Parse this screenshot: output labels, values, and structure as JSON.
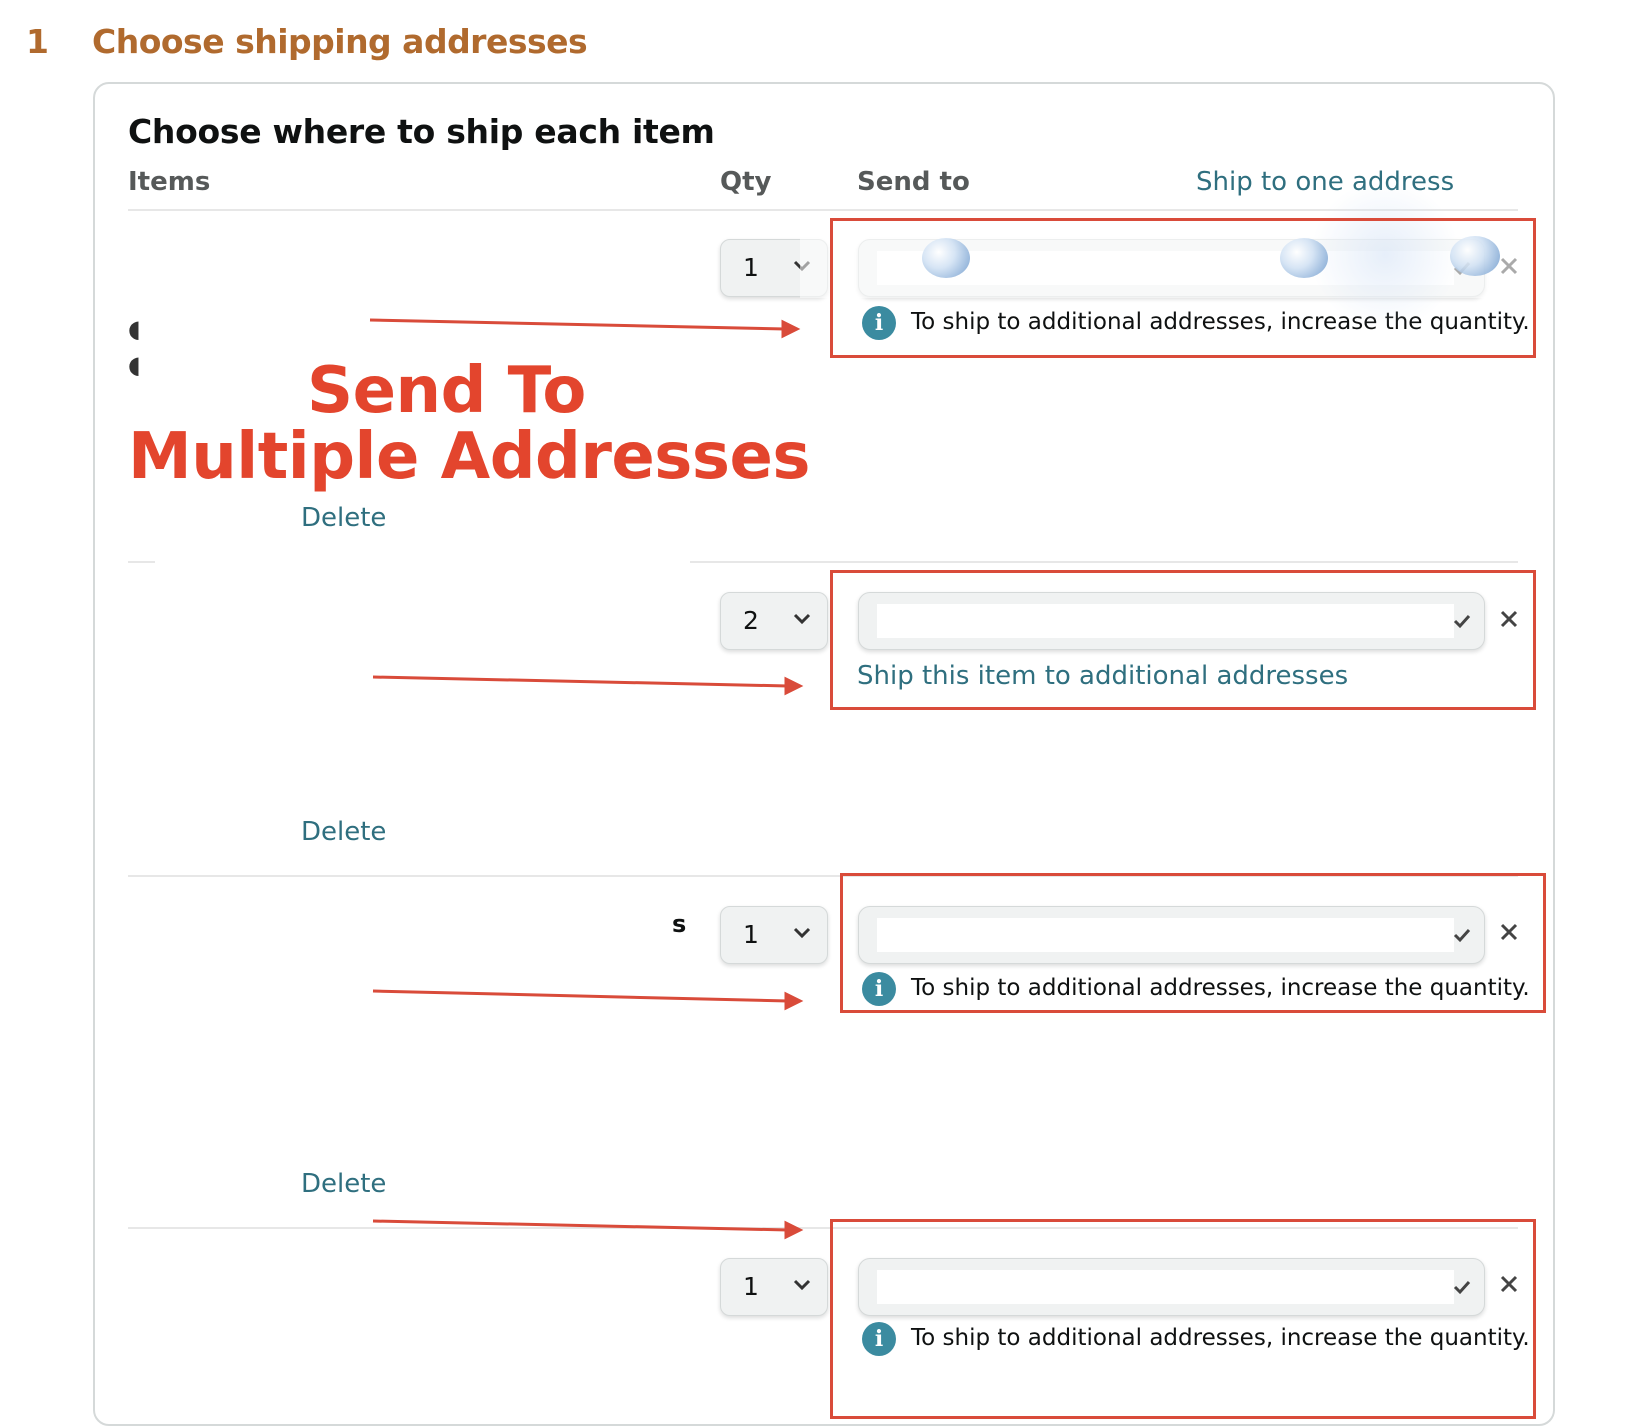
{
  "step": {
    "number": "1",
    "title": "Choose shipping addresses"
  },
  "card": {
    "title": "Choose where to ship each item",
    "columns": {
      "items": "Items",
      "qty": "Qty",
      "send_to": "Send to"
    },
    "ship_to_one_link": "Ship to one address"
  },
  "rows": [
    {
      "qty": "1",
      "address_value": "",
      "info": "To ship to additional addresses, increase the quantity.",
      "delete_label": "Delete"
    },
    {
      "qty": "2",
      "address_value": "",
      "ship_additional_link": "Ship this item to additional addresses",
      "delete_label": "Delete"
    },
    {
      "qty": "1",
      "address_value": "",
      "info": "To ship to additional addresses, increase the quantity.",
      "delete_label": "Delete",
      "item_text_residue": "s"
    },
    {
      "qty": "1",
      "address_value": "",
      "info": "To ship to additional addresses, increase the quantity."
    }
  ],
  "icons": {
    "info": "i",
    "remove": "close-icon",
    "qty_chevron": "chevron-down-icon",
    "address_check": "check-icon"
  },
  "annotation": {
    "line1": "Send To",
    "line2": "Multiple Addresses"
  },
  "colors": {
    "step_header": "#b06a2e",
    "link": "#2f6f7f",
    "annotation_red": "#e3452d",
    "info_icon": "#3b8ba0"
  }
}
